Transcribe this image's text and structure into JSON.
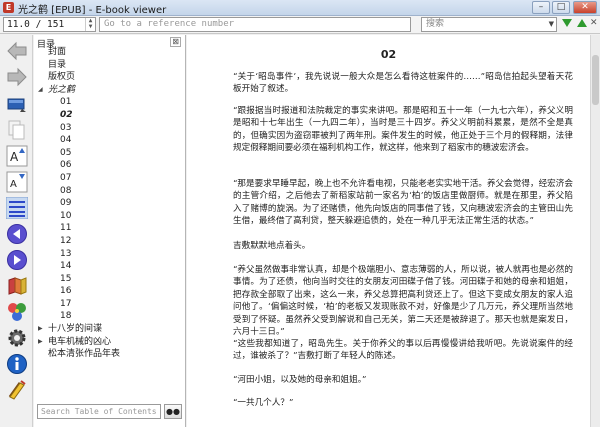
{
  "window": {
    "title": "光之鹤 [EPUB] - E-book viewer",
    "controls": [
      "–",
      "□",
      "✕"
    ]
  },
  "toolbar": {
    "page_position": "11.0 / 151",
    "reference_placeholder": "Go to a reference number",
    "search_placeholder": "搜索",
    "search_dropdown_glyph": "▼",
    "close_glyph": "✕"
  },
  "left_tools": [
    {
      "icon": "back-arrow-icon"
    },
    {
      "icon": "forward-arrow-icon"
    },
    {
      "icon": "open-ebook-icon"
    },
    {
      "icon": "copy-icon"
    },
    {
      "icon": "font-size-larger-icon"
    },
    {
      "icon": "font-size-smaller-icon"
    },
    {
      "icon": "table-of-contents-icon"
    },
    {
      "icon": "previous-page-icon"
    },
    {
      "icon": "next-page-icon"
    },
    {
      "icon": "bookmark-icon"
    },
    {
      "icon": "reference-mode-icon"
    },
    {
      "icon": "preferences-icon"
    },
    {
      "icon": "metadata-icon"
    },
    {
      "icon": "print-icon"
    }
  ],
  "toc": {
    "header": "目录",
    "close_glyph": "⊠",
    "search_placeholder": "Search Table of Contents",
    "search_button_glyph": "🔍",
    "items": [
      {
        "label": "封面",
        "level": 1
      },
      {
        "label": "目录",
        "level": 1
      },
      {
        "label": "版权页",
        "level": 1
      },
      {
        "label": "光之鹤",
        "level": 1,
        "expanded": true,
        "current": true
      },
      {
        "label": "01",
        "level": 2
      },
      {
        "label": "02",
        "level": 2,
        "selected": true
      },
      {
        "label": "03",
        "level": 2
      },
      {
        "label": "04",
        "level": 2
      },
      {
        "label": "05",
        "level": 2
      },
      {
        "label": "06",
        "level": 2
      },
      {
        "label": "07",
        "level": 2
      },
      {
        "label": "08",
        "level": 2
      },
      {
        "label": "09",
        "level": 2
      },
      {
        "label": "10",
        "level": 2
      },
      {
        "label": "11",
        "level": 2
      },
      {
        "label": "12",
        "level": 2
      },
      {
        "label": "13",
        "level": 2
      },
      {
        "label": "14",
        "level": 2
      },
      {
        "label": "15",
        "level": 2
      },
      {
        "label": "16",
        "level": 2
      },
      {
        "label": "17",
        "level": 2
      },
      {
        "label": "18",
        "level": 2
      },
      {
        "label": "十八岁的间谍",
        "level": 1,
        "collapsed": true
      },
      {
        "label": "电车机械的凶心",
        "level": 1,
        "collapsed": true
      },
      {
        "label": "松本清张作品年表",
        "level": 1
      }
    ]
  },
  "reader": {
    "chapter_title": "02",
    "paragraphs": [
      "“关于‘昭岛事件’，我先说说一般大众是怎么看待这桩案件的……”昭岛信拍起头望着天花板开始了叙述。",
      "“跟报据当时报道和法院裁定的事实来讲吧。那是昭和五十一年（一九七六年），养父义明是昭和十七年出生（一九四二年），当时是三十四岁。养父义明前科累累，是然不全是真的，但确实因为盗窃罪被判了两年刑。案件发生的时候，他正处于三个月的假释期，法律规定假释期间要必须在福利机构工作，就这样，他来到了稻家市的穗波宏济会。",
      "“那是要求早睡早起，晚上也不允许看电视，只能老老实实地干活。养父会觉得，经宏济会的主管介绍，之后他去了新稻家站前一家名为‘柏’的饭店里做厨师。就是在那里，养父陷入了赌博的旋涡。为了还赌债，他先向饭店的同事借了钱，又向穗波宏济会的主管田山先生借，最终借了高利贷，整天躲避追债的，处在一种几乎无法正常生活的状态。”",
      "吉敷默默地点着头。",
      "“养父虽然做事非常认真，却是个极端胆小、意志薄弱的人，所以说，被人就再也是必然的事情。为了还债，他向当时交往的女朋友河田碟子借了钱。河田碟子和她的母亲和姐姐，把存款全部取了出来，这么一来，养父总算把高利贷还上了。但这下变成女朋友的家人追问他了。‘偏偏这时候，‘柏’的老板又发现账款不对，好像是少了几万元，养父理所当然地受到了怀疑。虽然养父受到解说和自己无关，第二天还是被辞退了。那天也就是案发日，六月十三日。”",
      "“这些我都知道了，昭岛先生。关于你养父的事以后再慢慢讲给我听吧。先说说案件的经过，谁被杀了？”吉敷打断了年轻人的陈述。",
      "“河田小姐，以及她的母亲和姐姐。”",
      "“一共几个人？”"
    ]
  }
}
